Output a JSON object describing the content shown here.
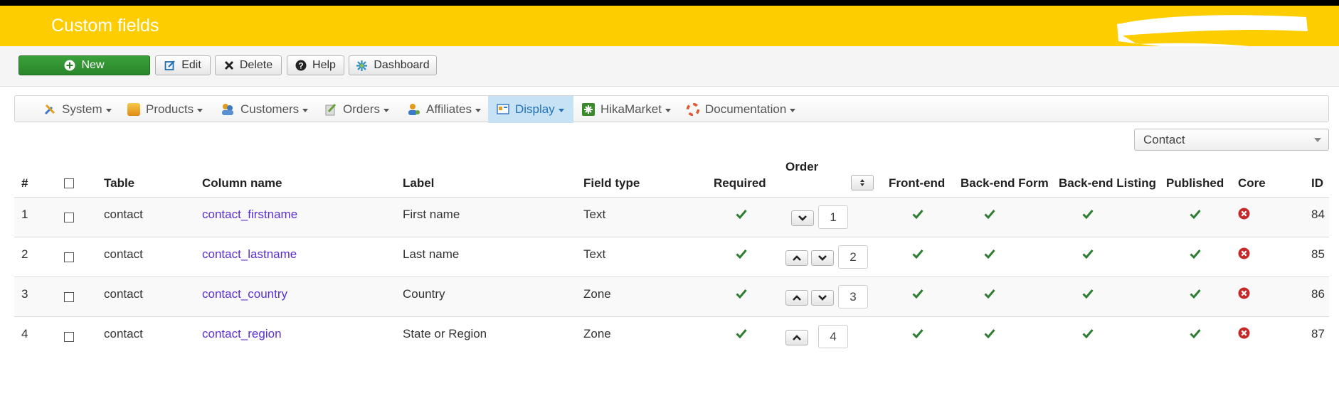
{
  "header": {
    "title": "Custom fields"
  },
  "toolbar": {
    "buttons": [
      {
        "label": "New",
        "icon": "plus-circle-icon"
      },
      {
        "label": "Edit",
        "icon": "edit-icon"
      },
      {
        "label": "Delete",
        "icon": "delete-x-icon"
      },
      {
        "label": "Help",
        "icon": "help-circle-icon"
      },
      {
        "label": "Dashboard",
        "icon": "dashboard-icon"
      }
    ]
  },
  "menu": {
    "items": [
      {
        "label": "System",
        "icon": "system-tools-icon"
      },
      {
        "label": "Products",
        "icon": "products-box-icon"
      },
      {
        "label": "Customers",
        "icon": "customers-users-icon"
      },
      {
        "label": "Orders",
        "icon": "orders-icon"
      },
      {
        "label": "Affiliates",
        "icon": "affiliates-icon"
      },
      {
        "label": "Display",
        "icon": "display-icon",
        "active": true
      },
      {
        "label": "HikaMarket",
        "icon": "hikamarket-icon"
      },
      {
        "label": "Documentation",
        "icon": "lifebuoy-icon"
      }
    ]
  },
  "filter": {
    "selected": "Contact"
  },
  "table": {
    "headers": {
      "num": "#",
      "table": "Table",
      "column": "Column name",
      "label": "Label",
      "type": "Field type",
      "required": "Required",
      "order": "Order",
      "frontend": "Front-end",
      "backform": "Back-end Form",
      "backlist": "Back-end Listing",
      "published": "Published",
      "core": "Core",
      "id": "ID"
    },
    "rows": [
      {
        "num": "1",
        "table": "contact",
        "column": "contact_firstname",
        "label": "First name",
        "type": "Text",
        "order": "1",
        "id": "84",
        "up": false,
        "down": true
      },
      {
        "num": "2",
        "table": "contact",
        "column": "contact_lastname",
        "label": "Last name",
        "type": "Text",
        "order": "2",
        "id": "85",
        "up": true,
        "down": true
      },
      {
        "num": "3",
        "table": "contact",
        "column": "contact_country",
        "label": "Country",
        "type": "Zone",
        "order": "3",
        "id": "86",
        "up": true,
        "down": true
      },
      {
        "num": "4",
        "table": "contact",
        "column": "contact_region",
        "label": "State or Region",
        "type": "Zone",
        "order": "4",
        "id": "87",
        "up": true,
        "down": false
      }
    ]
  },
  "colors": {
    "header": "#fdcd00",
    "check": "#2e7d32",
    "core_x": "#c62828",
    "link": "#5a2fd6"
  }
}
